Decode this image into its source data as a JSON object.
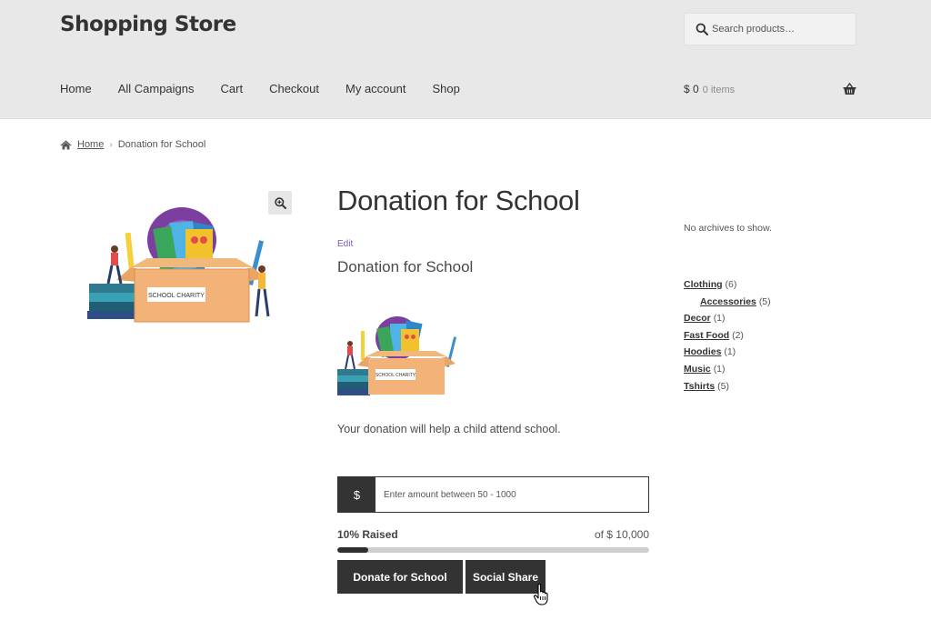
{
  "site": {
    "title": "Shopping Store"
  },
  "search": {
    "placeholder": "Search products…"
  },
  "nav": {
    "items": [
      {
        "label": "Home"
      },
      {
        "label": "All Campaigns"
      },
      {
        "label": "Cart"
      },
      {
        "label": "Checkout"
      },
      {
        "label": "My account"
      },
      {
        "label": "Shop"
      }
    ]
  },
  "cart": {
    "total": "$ 0",
    "count": "0 items",
    "icon": "basket-icon"
  },
  "breadcrumb": {
    "home_label": "Home",
    "separator": "›",
    "current": "Donation for School"
  },
  "product": {
    "title": "Donation for School",
    "edit_label": "Edit",
    "subtitle": "Donation for School",
    "description": "Your donation will help a child attend school.",
    "image_label": "SCHOOL CHARITY"
  },
  "donation": {
    "currency": "$",
    "amount_placeholder": "Enter amount between 50 - 1000",
    "raised_label": "10% Raised",
    "raised_fraction": 0.1,
    "goal_label": "of $ 10,000",
    "donate_button": "Donate for School",
    "share_button": "Social Share"
  },
  "sidebar": {
    "no_archives": "No archives to show.",
    "categories": [
      {
        "name": "Clothing",
        "count": "(6)",
        "child": false
      },
      {
        "name": "Accessories",
        "count": "(5)",
        "child": true
      },
      {
        "name": "Decor",
        "count": "(1)",
        "child": false
      },
      {
        "name": "Fast Food",
        "count": "(2)",
        "child": false
      },
      {
        "name": "Hoodies",
        "count": "(1)",
        "child": false
      },
      {
        "name": "Music",
        "count": "(1)",
        "child": false
      },
      {
        "name": "Tshirts",
        "count": "(5)",
        "child": false
      }
    ]
  },
  "colors": {
    "header_bg": "#e8e8e8",
    "button_bg": "#333333",
    "edit_link": "#7f54b3",
    "progress_track": "#cfcfcf",
    "progress_fill": "#2f2f2f"
  }
}
